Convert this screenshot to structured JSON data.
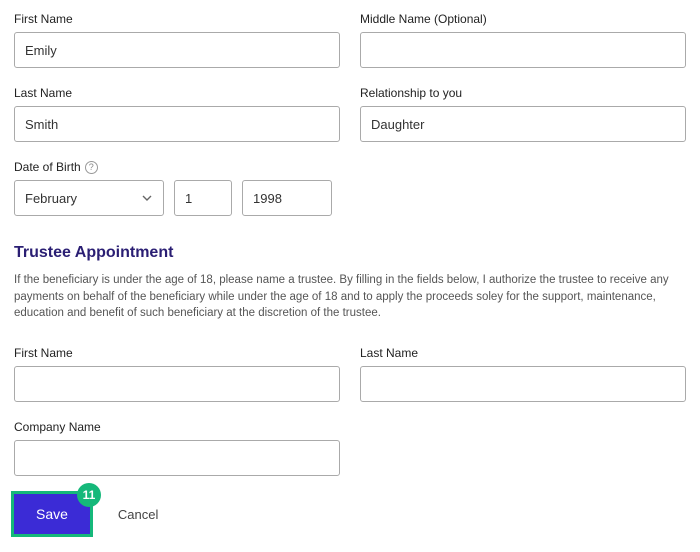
{
  "beneficiary": {
    "first_name_label": "First Name",
    "first_name_value": "Emily",
    "middle_name_label": "Middle Name (Optional)",
    "middle_name_value": "",
    "last_name_label": "Last Name",
    "last_name_value": "Smith",
    "relationship_label": "Relationship to you",
    "relationship_value": "Daughter",
    "dob_label": "Date of Birth",
    "dob_month": "February",
    "dob_day": "1",
    "dob_year": "1998"
  },
  "trustee": {
    "heading": "Trustee Appointment",
    "description": "If the beneficiary is under the age of 18, please name a trustee. By filling in the fields below, I authorize the trustee to receive any payments on behalf of the beneficiary while under the age of 18 and to apply the proceeds soley for the support, maintenance, education and benefit of such beneficiary at the discretion of the trustee.",
    "first_name_label": "First Name",
    "first_name_value": "",
    "last_name_label": "Last Name",
    "last_name_value": "",
    "company_label": "Company Name",
    "company_value": ""
  },
  "actions": {
    "save_label": "Save",
    "cancel_label": "Cancel",
    "badge": "11"
  }
}
